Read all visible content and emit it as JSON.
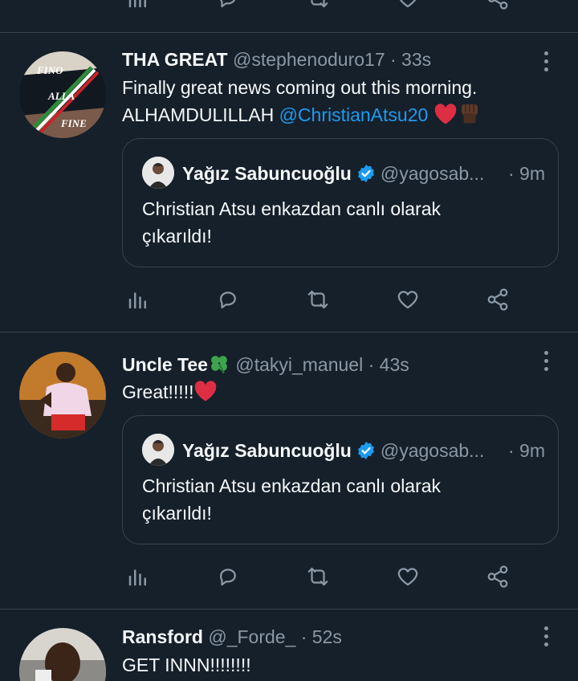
{
  "tweets": [
    {
      "name": "THA GREAT",
      "handle": "@stephenoduro17",
      "time": "· 33s",
      "text_line1": "Finally great news coming out this morning.",
      "text_line2_prefix": "ALHAMDULILLAH ",
      "mention": "@ChristianAtsu20",
      "avatar_text": [
        "FINO",
        "ALLA",
        "FINE"
      ],
      "quote": {
        "name": "Yağız Sabuncuoğlu",
        "handle": "@yagosab...",
        "time": "· 9m",
        "text_line1": "Christian Atsu enkazdan canlı olarak",
        "text_line2": "çıkarıldı!"
      }
    },
    {
      "name": "Uncle Tee",
      "handle": "@takyi_manuel",
      "time": "· 43s",
      "text": "Great!!!!!",
      "quote": {
        "name": "Yağız Sabuncuoğlu",
        "handle": "@yagosab...",
        "time": "· 9m",
        "text_line1": "Christian Atsu enkazdan canlı olarak",
        "text_line2": "çıkarıldı!"
      }
    },
    {
      "name": "Ransford",
      "handle": "@_Forde_",
      "time": "· 52s",
      "text": "GET INNN!!!!!!!!"
    }
  ],
  "colors": {
    "background": "#15202b",
    "text": "#f7f9f9",
    "secondary": "#8b98a5",
    "border": "#38444d",
    "accent": "#1d9bf0",
    "heart_emoji": "#e0245e"
  },
  "icons": [
    "analytics-icon",
    "reply-icon",
    "retweet-icon",
    "like-icon",
    "share-icon",
    "more-icon",
    "verified-icon"
  ]
}
